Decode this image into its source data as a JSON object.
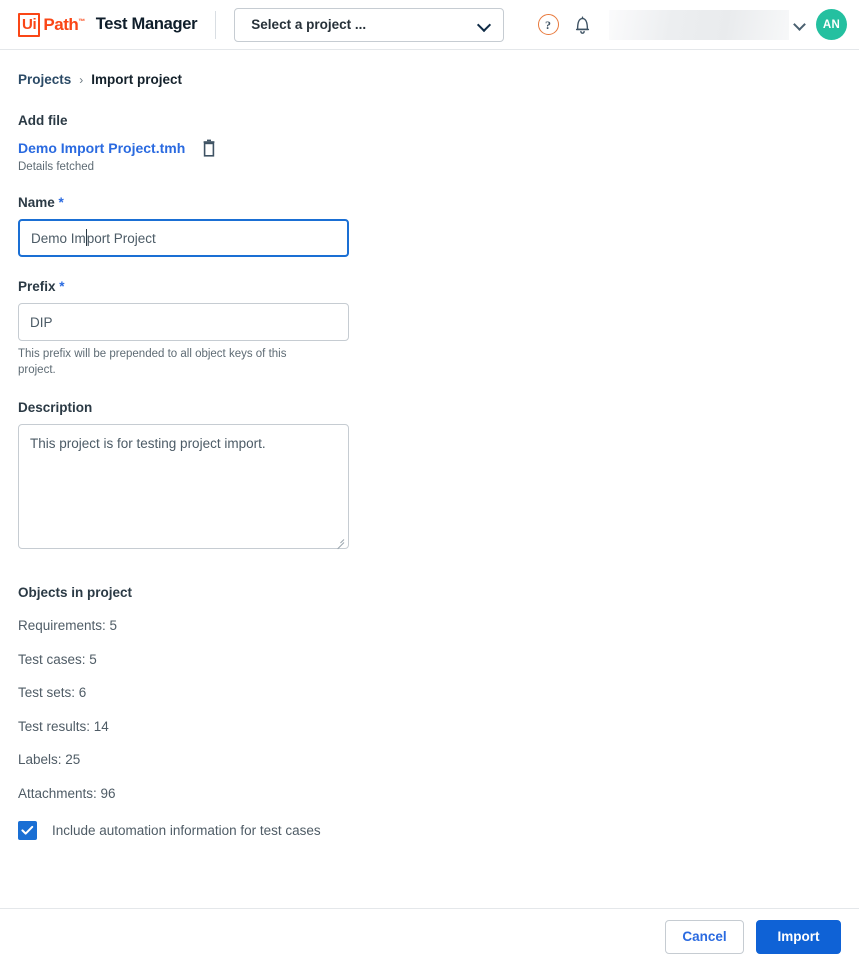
{
  "header": {
    "logo_ui": "Ui",
    "logo_path": "Path",
    "logo_tm": "™",
    "app_name": "Test Manager",
    "project_selector": {
      "value": "Select a project ...",
      "icon": "chevron-down-icon"
    },
    "help_icon": "help-circle-icon",
    "help_glyph": "?",
    "notifications_icon": "bell-icon",
    "tenant_selector": {
      "value": "",
      "icon": "chevron-down-icon"
    },
    "avatar": {
      "initials": "AN",
      "color": "#24c0a0"
    }
  },
  "breadcrumb": {
    "root": "Projects",
    "separator": "›",
    "current": "Import project"
  },
  "add_file": {
    "title": "Add file",
    "file_name": "Demo Import Project.tmh",
    "delete_icon": "trash-icon",
    "status": "Details fetched"
  },
  "form": {
    "name": {
      "label": "Name",
      "required_marker": "*",
      "value_before_caret": "Demo Im",
      "value_after_caret": "port Project",
      "value": "Demo Import Project",
      "focused": true
    },
    "prefix": {
      "label": "Prefix",
      "required_marker": "*",
      "value": "DIP",
      "hint": "This prefix will be prepended to all object keys of this project."
    },
    "description": {
      "label": "Description",
      "value": "This project is for testing project import."
    }
  },
  "objects": {
    "title": "Objects in project",
    "rows": [
      {
        "label": "Requirements",
        "value": "5",
        "text": "Requirements: 5"
      },
      {
        "label": "Test cases",
        "value": "5",
        "text": "Test cases: 5"
      },
      {
        "label": "Test sets",
        "value": "6",
        "text": "Test sets: 6"
      },
      {
        "label": "Test results",
        "value": "14",
        "text": "Test results: 14"
      },
      {
        "label": "Labels",
        "value": "25",
        "text": "Labels: 25"
      },
      {
        "label": "Attachments",
        "value": "96",
        "text": "Attachments: 96"
      }
    ],
    "checkbox": {
      "label": "Include automation information for test cases",
      "checked": true
    }
  },
  "footer": {
    "cancel_label": "Cancel",
    "import_label": "Import"
  },
  "colors": {
    "brand_orange": "#fa4616",
    "link_blue": "#2a6ae0",
    "primary_blue": "#0f62d6",
    "focus_blue": "#1a6fd4",
    "avatar_green": "#24c0a0"
  }
}
